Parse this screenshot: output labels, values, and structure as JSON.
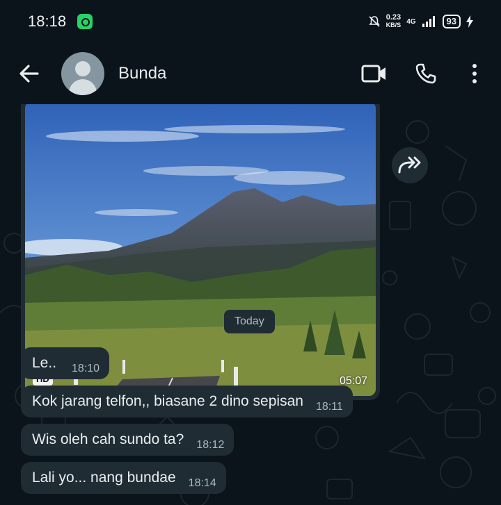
{
  "status_bar": {
    "time": "18:18",
    "data_rate_value": "0.23",
    "data_rate_unit": "KB/S",
    "network": "4G",
    "battery": "93"
  },
  "header": {
    "contact_name": "Bunda",
    "icons": [
      "back-arrow-icon",
      "avatar",
      "video-call-icon",
      "phone-icon",
      "more-options-icon"
    ]
  },
  "media": {
    "badge": "HD",
    "duration": "05:07"
  },
  "date_divider": "Today",
  "messages": [
    {
      "text": "Le..",
      "time": "18:10"
    },
    {
      "text": "Kok jarang telfon,, biasane 2 dino sepisan",
      "time": "18:11"
    },
    {
      "text": "Wis oleh cah sundo ta?",
      "time": "18:12"
    },
    {
      "text": "Lali yo... nang bundae",
      "time": "18:14"
    }
  ],
  "colors": {
    "background": "#0b141a",
    "bubble": "#1f2c34",
    "text": "#e9edef",
    "meta": "#aebac1"
  }
}
